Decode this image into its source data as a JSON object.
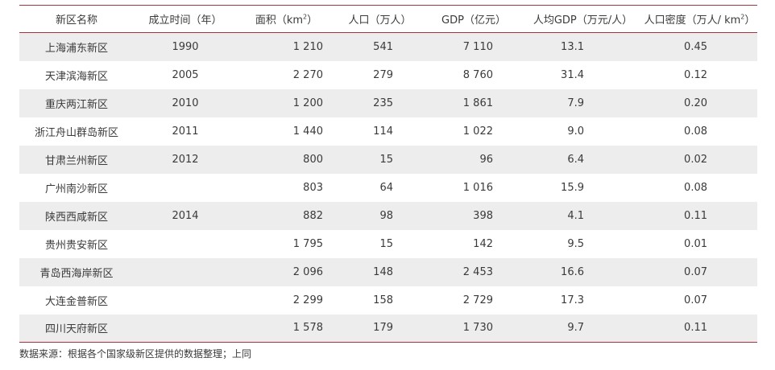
{
  "table": {
    "headers": {
      "name": "新区名称",
      "year": "成立时间（年）",
      "area_prefix": "面积（km",
      "area_sup": "2",
      "area_suffix": "）",
      "population": "人口（万人）",
      "gdp": "GDP（亿元）",
      "gdp_per_capita": "人均GDP（万元/人）",
      "density_prefix": "人口密度（万人/ km",
      "density_sup": "2",
      "density_suffix": "）"
    },
    "rows": [
      {
        "name": "上海浦东新区",
        "year": "1990",
        "area": "1 210",
        "population": "541",
        "gdp": "7 110",
        "gdp_per_capita": "13.1",
        "density": "0.45"
      },
      {
        "name": "天津滨海新区",
        "year": "2005",
        "area": "2 270",
        "population": "279",
        "gdp": "8 760",
        "gdp_per_capita": "31.4",
        "density": "0.12"
      },
      {
        "name": "重庆两江新区",
        "year": "2010",
        "area": "1 200",
        "population": "235",
        "gdp": "1 861",
        "gdp_per_capita": "7.9",
        "density": "0.20"
      },
      {
        "name": "浙江舟山群岛新区",
        "year": "2011",
        "area": "1 440",
        "population": "114",
        "gdp": "1 022",
        "gdp_per_capita": "9.0",
        "density": "0.08"
      },
      {
        "name": "甘肃兰州新区",
        "year": "2012",
        "area": "800",
        "population": "15",
        "gdp": "96",
        "gdp_per_capita": "6.4",
        "density": "0.02"
      },
      {
        "name": "广州南沙新区",
        "year": "",
        "area": "803",
        "population": "64",
        "gdp": "1 016",
        "gdp_per_capita": "15.9",
        "density": "0.08"
      },
      {
        "name": "陕西西咸新区",
        "year": "2014",
        "area": "882",
        "population": "98",
        "gdp": "398",
        "gdp_per_capita": "4.1",
        "density": "0.11"
      },
      {
        "name": "贵州贵安新区",
        "year": "",
        "area": "1 795",
        "population": "15",
        "gdp": "142",
        "gdp_per_capita": "9.5",
        "density": "0.01"
      },
      {
        "name": "青岛西海岸新区",
        "year": "",
        "area": "2 096",
        "population": "148",
        "gdp": "2 453",
        "gdp_per_capita": "16.6",
        "density": "0.07"
      },
      {
        "name": "大连金普新区",
        "year": "",
        "area": "2 299",
        "population": "158",
        "gdp": "2 729",
        "gdp_per_capita": "17.3",
        "density": "0.07"
      },
      {
        "name": "四川天府新区",
        "year": "",
        "area": "1 578",
        "population": "179",
        "gdp": "1 730",
        "gdp_per_capita": "9.7",
        "density": "0.11"
      }
    ]
  },
  "source_note": "数据来源：根据各个国家级新区提供的数据整理；上同",
  "colors": {
    "rule": "#a1343c",
    "shade": "#ededed",
    "text": "#3a3a3a"
  }
}
